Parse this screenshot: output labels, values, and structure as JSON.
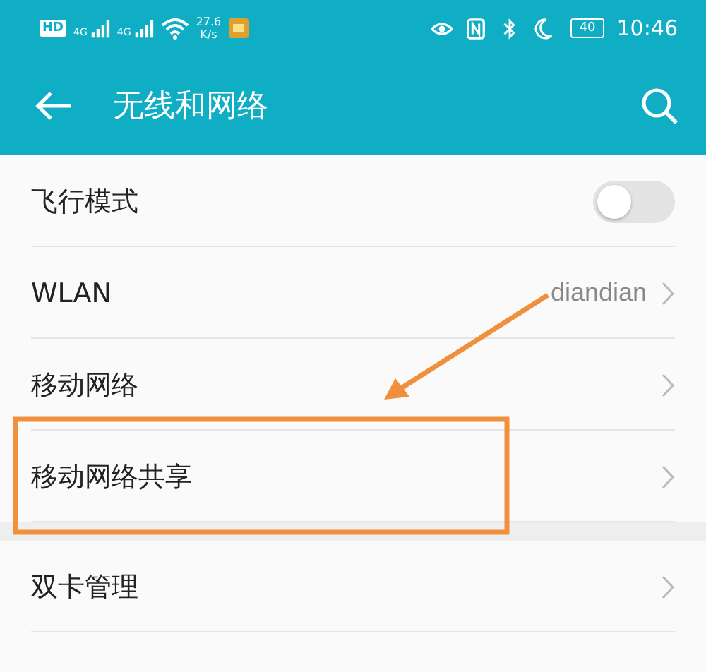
{
  "status_bar": {
    "hd": "HD",
    "signals": [
      "4G",
      "4G"
    ],
    "speed": "27.6",
    "speed_unit": "K/s",
    "battery": "40",
    "time": "10:46"
  },
  "header": {
    "title": "无线和网络"
  },
  "sections": [
    {
      "items": [
        {
          "kind": "toggle",
          "label": "飞行模式",
          "on": false
        },
        {
          "kind": "link",
          "label": "WLAN",
          "value": "diandian"
        },
        {
          "kind": "link",
          "label": "移动网络"
        },
        {
          "kind": "link",
          "label": "移动网络共享"
        }
      ]
    },
    {
      "items": [
        {
          "kind": "link",
          "label": "双卡管理"
        }
      ]
    }
  ]
}
